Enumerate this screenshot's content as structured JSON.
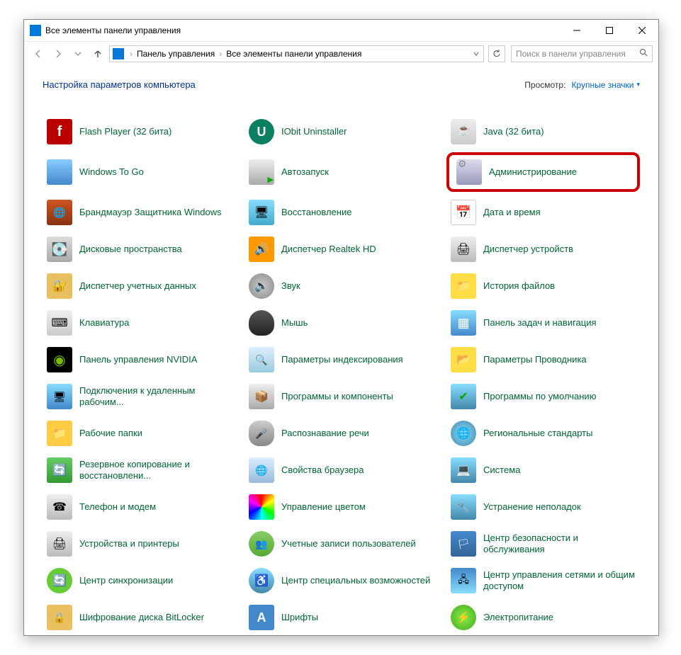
{
  "window": {
    "title": "Все элементы панели управления"
  },
  "nav": {
    "breadcrumb": [
      "Панель управления",
      "Все элементы панели управления"
    ]
  },
  "search": {
    "placeholder": "Поиск в панели управления"
  },
  "header": {
    "title": "Настройка параметров компьютера",
    "view_label": "Просмотр:",
    "view_value": "Крупные значки"
  },
  "items": [
    {
      "label": "Flash Player (32 бита)",
      "icon": "ic-flash",
      "name": "flash-player"
    },
    {
      "label": "IObit Uninstaller",
      "icon": "ic-iobit",
      "name": "iobit-uninstaller"
    },
    {
      "label": "Java (32 бита)",
      "icon": "ic-java",
      "name": "java"
    },
    {
      "label": "Windows To Go",
      "icon": "ic-wtg",
      "name": "windows-to-go"
    },
    {
      "label": "Автозапуск",
      "icon": "ic-autorun",
      "name": "autorun"
    },
    {
      "label": "Администрирование",
      "icon": "ic-admin",
      "name": "administration",
      "highlight": true
    },
    {
      "label": "Брандмауэр Защитника Windows",
      "icon": "ic-firewall",
      "name": "firewall"
    },
    {
      "label": "Восстановление",
      "icon": "ic-recovery",
      "name": "recovery"
    },
    {
      "label": "Дата и время",
      "icon": "ic-datetime",
      "name": "date-time"
    },
    {
      "label": "Дисковые пространства",
      "icon": "ic-diskspace",
      "name": "storage-spaces"
    },
    {
      "label": "Диспетчер Realtek HD",
      "icon": "ic-realtek",
      "name": "realtek"
    },
    {
      "label": "Диспетчер устройств",
      "icon": "ic-devmgr",
      "name": "device-manager"
    },
    {
      "label": "Диспетчер учетных данных",
      "icon": "ic-credmgr",
      "name": "credential-manager"
    },
    {
      "label": "Звук",
      "icon": "ic-sound",
      "name": "sound"
    },
    {
      "label": "История файлов",
      "icon": "ic-filehistory",
      "name": "file-history"
    },
    {
      "label": "Клавиатура",
      "icon": "ic-keyboard",
      "name": "keyboard"
    },
    {
      "label": "Мышь",
      "icon": "ic-mouse",
      "name": "mouse"
    },
    {
      "label": "Панель задач и навигация",
      "icon": "ic-taskbar",
      "name": "taskbar"
    },
    {
      "label": "Панель управления NVIDIA",
      "icon": "ic-nvidia",
      "name": "nvidia"
    },
    {
      "label": "Параметры индексирования",
      "icon": "ic-indexing",
      "name": "indexing"
    },
    {
      "label": "Параметры Проводника",
      "icon": "ic-explorer",
      "name": "explorer-options"
    },
    {
      "label": "Подключения к удаленным рабочим...",
      "icon": "ic-rdp",
      "name": "remote-desktop"
    },
    {
      "label": "Программы и компоненты",
      "icon": "ic-programs",
      "name": "programs"
    },
    {
      "label": "Программы по умолчанию",
      "icon": "ic-defprog",
      "name": "default-programs"
    },
    {
      "label": "Рабочие папки",
      "icon": "ic-workfolders",
      "name": "work-folders"
    },
    {
      "label": "Распознавание речи",
      "icon": "ic-speech",
      "name": "speech"
    },
    {
      "label": "Региональные стандарты",
      "icon": "ic-region",
      "name": "region"
    },
    {
      "label": "Резервное копирование и восстановлени...",
      "icon": "ic-backup",
      "name": "backup"
    },
    {
      "label": "Свойства браузера",
      "icon": "ic-internet",
      "name": "internet-options"
    },
    {
      "label": "Система",
      "icon": "ic-system",
      "name": "system"
    },
    {
      "label": "Телефон и модем",
      "icon": "ic-phone",
      "name": "phone-modem"
    },
    {
      "label": "Управление цветом",
      "icon": "ic-color",
      "name": "color-management"
    },
    {
      "label": "Устранение неполадок",
      "icon": "ic-troubleshoot",
      "name": "troubleshooting"
    },
    {
      "label": "Устройства и принтеры",
      "icon": "ic-printers",
      "name": "devices-printers"
    },
    {
      "label": "Учетные записи пользователей",
      "icon": "ic-accounts",
      "name": "user-accounts"
    },
    {
      "label": "Центр безопасности и обслуживания",
      "icon": "ic-security",
      "name": "security-center"
    },
    {
      "label": "Центр синхронизации",
      "icon": "ic-sync",
      "name": "sync-center"
    },
    {
      "label": "Центр специальных возможностей",
      "icon": "ic-access",
      "name": "ease-of-access"
    },
    {
      "label": "Центр управления сетями и общим доступом",
      "icon": "ic-network",
      "name": "network-center"
    },
    {
      "label": "Шифрование диска BitLocker",
      "icon": "ic-bitlocker",
      "name": "bitlocker"
    },
    {
      "label": "Шрифты",
      "icon": "ic-fonts",
      "name": "fonts"
    },
    {
      "label": "Электропитание",
      "icon": "ic-power",
      "name": "power-options"
    }
  ]
}
